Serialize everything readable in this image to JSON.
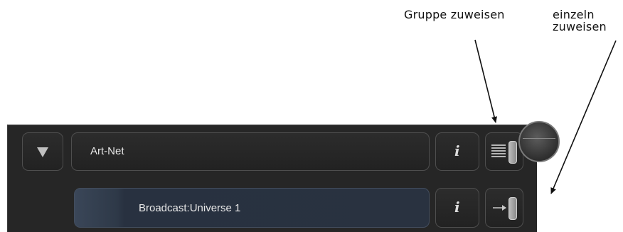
{
  "annotations": {
    "group_assign": "Gruppe zuweisen",
    "single_assign_line1": "einzeln",
    "single_assign_line2": "zuweisen"
  },
  "panel": {
    "group_row": {
      "label": "Art-Net",
      "info_label": "i"
    },
    "universe_row": {
      "label": "Broadcast:Universe 1",
      "info_label": "i"
    }
  },
  "colors": {
    "panel_bg": "#262626",
    "row_selected": "#293240",
    "text": "#e8e8e8"
  },
  "icons": {
    "collapse": "triangle-down-icon",
    "group_assign": "lines-slider-icon",
    "single_assign": "arrow-to-bar-icon"
  }
}
